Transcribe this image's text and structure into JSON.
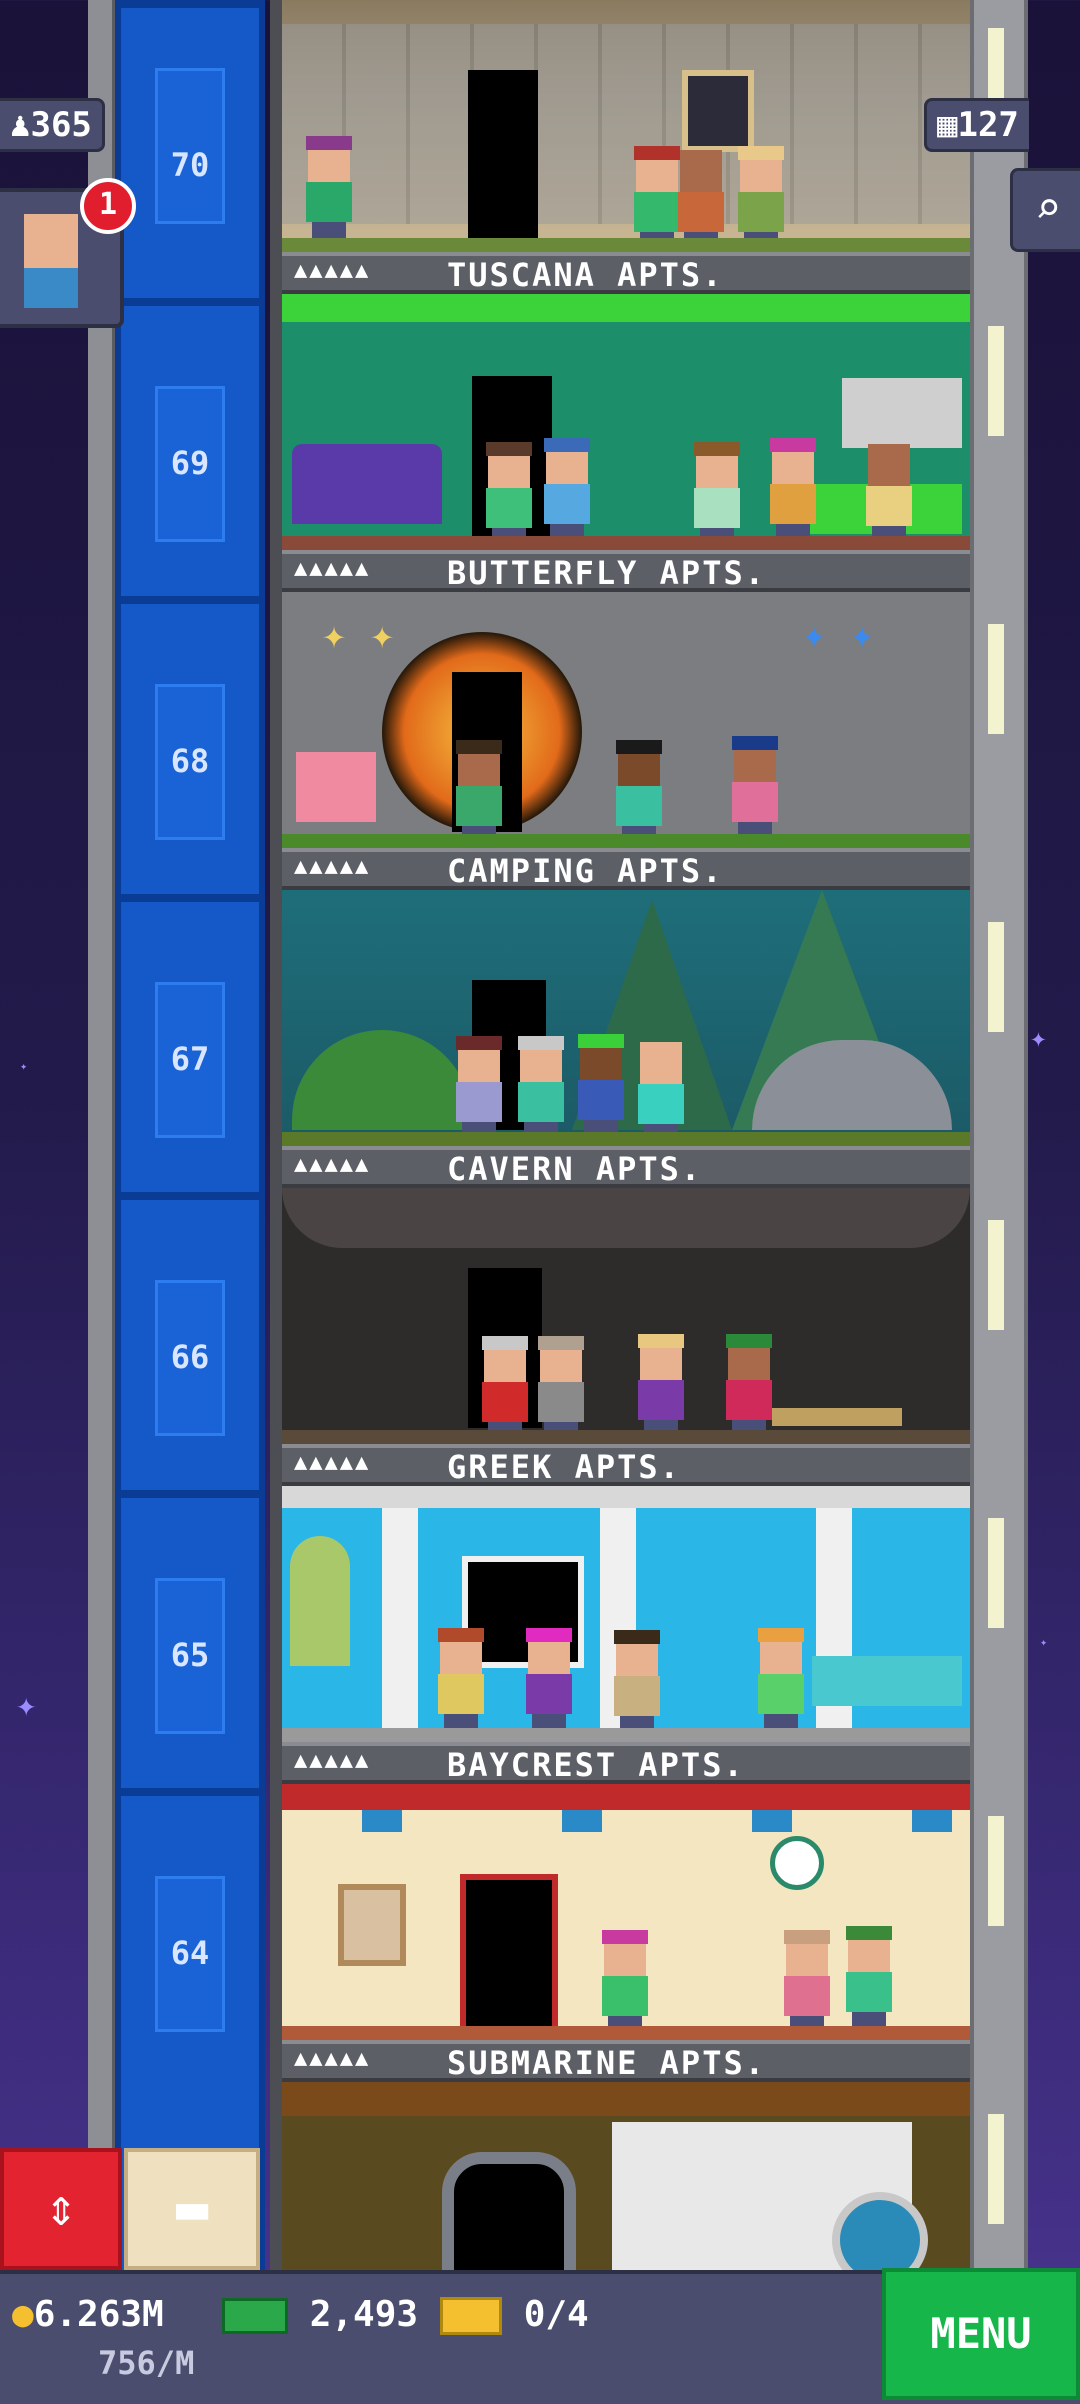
{
  "hud": {
    "population": "365",
    "floors_count": "127",
    "visitor_badge": "1"
  },
  "floors": [
    {
      "number": "70",
      "name": "TUSCANA APTS.",
      "stars": "▲▲▲▲▲"
    },
    {
      "number": "69",
      "name": "BUTTERFLY APTS.",
      "stars": "▲▲▲▲▲"
    },
    {
      "number": "68",
      "name": "CAMPING APTS.",
      "stars": "▲▲▲▲▲"
    },
    {
      "number": "67",
      "name": "CAVERN APTS.",
      "stars": "▲▲▲▲▲"
    },
    {
      "number": "66",
      "name": "GREEK APTS.",
      "stars": "▲▲▲▲▲"
    },
    {
      "number": "65",
      "name": "BAYCREST APTS.",
      "stars": "▲▲▲▲▲"
    },
    {
      "number": "64",
      "name": "SUBMARINE APTS.",
      "stars": "▲▲▲▲▲"
    }
  ],
  "bottom": {
    "coins": "6.263M",
    "coin_rate": "756/M",
    "bux": "2,493",
    "tickets": "0/4",
    "menu_label": "MENU"
  },
  "icons": {
    "population": "person-icon",
    "floors": "building-icon",
    "search": "magnifier-icon",
    "elevator": "up-down-arrows-icon",
    "storage": "box-icon",
    "coin": "coin-icon",
    "bux": "cash-icon",
    "ticket": "ticket-icon"
  },
  "colors": {
    "menu": "#16b64a",
    "elevator_button": "#e3232f",
    "shaft": "#1559c8",
    "badge": "#e01e2e"
  }
}
